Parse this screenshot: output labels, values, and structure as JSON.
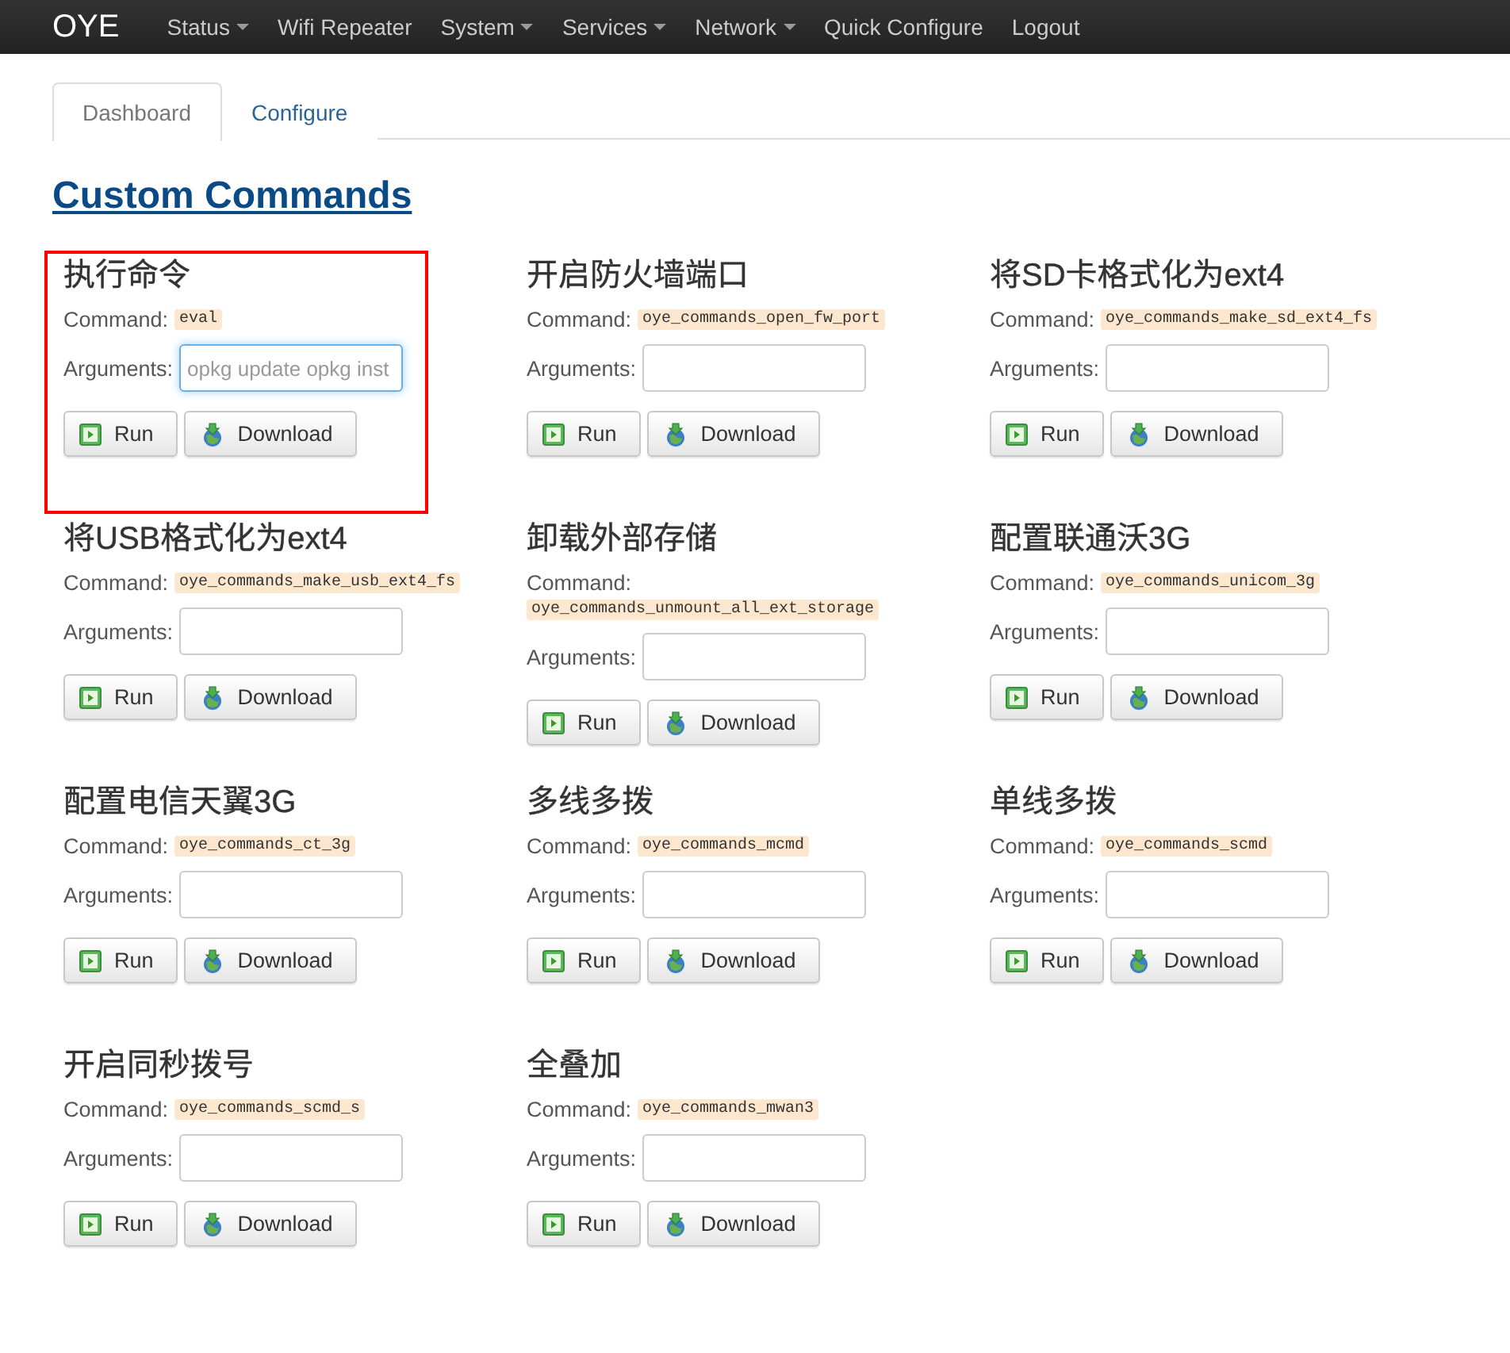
{
  "navbar": {
    "brand": "OYE",
    "items": [
      {
        "label": "Status",
        "dropdown": true
      },
      {
        "label": "Wifi Repeater",
        "dropdown": false
      },
      {
        "label": "System",
        "dropdown": true
      },
      {
        "label": "Services",
        "dropdown": true
      },
      {
        "label": "Network",
        "dropdown": true
      },
      {
        "label": "Quick Configure",
        "dropdown": false
      },
      {
        "label": "Logout",
        "dropdown": false
      }
    ]
  },
  "tabs": [
    {
      "label": "Dashboard",
      "selected": true
    },
    {
      "label": "Configure",
      "selected": false
    }
  ],
  "title": "Custom Commands",
  "commands": [
    {
      "name": "执行命令",
      "command_label": "Command:",
      "command": "eval",
      "arguments_label": "Arguments:",
      "placeholder": "opkg update opkg inst",
      "focused": true,
      "highlighted": true,
      "run": "Run",
      "download": "Download"
    },
    {
      "name": "开启防火墙端口",
      "command_label": "Command:",
      "command": "oye_commands_open_fw_port",
      "arguments_label": "Arguments:",
      "focused": false,
      "highlighted": false,
      "run": "Run",
      "download": "Download"
    },
    {
      "name": "将SD卡格式化为ext4",
      "command_label": "Command:",
      "command": "oye_commands_make_sd_ext4_fs",
      "arguments_label": "Arguments:",
      "focused": false,
      "highlighted": false,
      "run": "Run",
      "download": "Download"
    },
    {
      "name": "将USB格式化为ext4",
      "command_label": "Command:",
      "command": "oye_commands_make_usb_ext4_fs",
      "arguments_label": "Arguments:",
      "focused": false,
      "highlighted": false,
      "run": "Run",
      "download": "Download"
    },
    {
      "name": "卸载外部存储",
      "command_label": "Command:",
      "command": "oye_commands_unmount_all_ext_storage",
      "arguments_label": "Arguments:",
      "focused": false,
      "highlighted": false,
      "run": "Run",
      "download": "Download"
    },
    {
      "name": "配置联通沃3G",
      "command_label": "Command:",
      "command": "oye_commands_unicom_3g",
      "arguments_label": "Arguments:",
      "focused": false,
      "highlighted": false,
      "run": "Run",
      "download": "Download"
    },
    {
      "name": "配置电信天翼3G",
      "command_label": "Command:",
      "command": "oye_commands_ct_3g",
      "arguments_label": "Arguments:",
      "focused": false,
      "highlighted": false,
      "run": "Run",
      "download": "Download"
    },
    {
      "name": "多线多拨",
      "command_label": "Command:",
      "command": "oye_commands_mcmd",
      "arguments_label": "Arguments:",
      "focused": false,
      "highlighted": false,
      "run": "Run",
      "download": "Download"
    },
    {
      "name": "单线多拨",
      "command_label": "Command:",
      "command": "oye_commands_scmd",
      "arguments_label": "Arguments:",
      "focused": false,
      "highlighted": false,
      "run": "Run",
      "download": "Download"
    },
    {
      "name": "开启同秒拨号",
      "command_label": "Command:",
      "command": "oye_commands_scmd_s",
      "arguments_label": "Arguments:",
      "focused": false,
      "highlighted": false,
      "run": "Run",
      "download": "Download"
    },
    {
      "name": "全叠加",
      "command_label": "Command:",
      "command": "oye_commands_mwan3",
      "arguments_label": "Arguments:",
      "focused": false,
      "highlighted": false,
      "run": "Run",
      "download": "Download"
    }
  ]
}
